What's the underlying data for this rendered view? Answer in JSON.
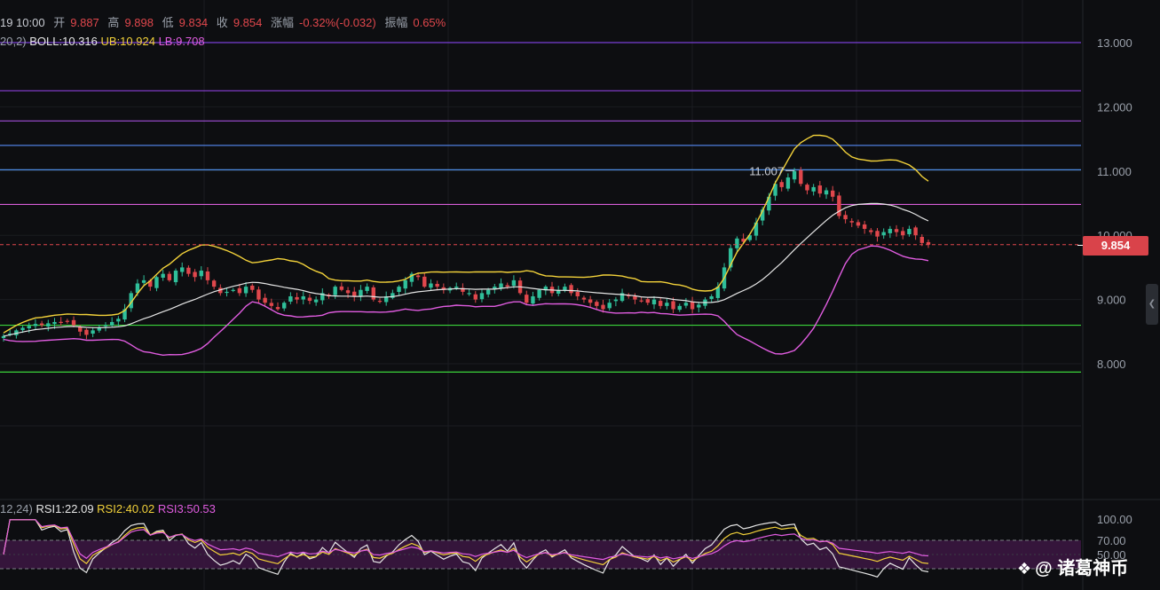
{
  "info": {
    "time": "19 10:00",
    "open_label": "开",
    "open": "9.887",
    "high_label": "高",
    "high": "9.898",
    "low_label": "低",
    "low": "9.834",
    "close_label": "收",
    "close": "9.854",
    "change_label": "涨幅",
    "change": "-0.32%(-0.032)",
    "amp_label": "振幅",
    "amp": "0.65%"
  },
  "boll": {
    "params": "20,2)",
    "mid": "BOLL:10.316",
    "ub": "UB:10.924",
    "lb": "LB:9.708"
  },
  "rsi": {
    "params": "12,24)",
    "rsi1": "RSI1:22.09",
    "rsi2": "RSI2:40.02",
    "rsi3": "RSI3:50.53"
  },
  "current_price": "9.854",
  "high_marker": "11.007",
  "scroll_icon": "chevron-left-icon",
  "watermark": {
    "icon": "diamond-logo-icon",
    "text": "@ 诸葛神币"
  },
  "colors": {
    "up": "#2fbf9a",
    "down": "#e0474c",
    "mid": "#e6e6e6",
    "ub": "#f3d23a",
    "lb": "#e05ce0"
  },
  "chart_data": {
    "type": "candlestick",
    "price_axis": {
      "ticks": [
        13,
        12,
        11,
        10,
        9,
        8
      ],
      "tick_labels": [
        "13.000",
        "12.000",
        "11.000",
        "10.000",
        "9.000",
        "8.000"
      ]
    },
    "rsi_axis": {
      "ticks": [
        100,
        70,
        50
      ],
      "tick_labels": [
        "100.00",
        "70.00",
        "50.00"
      ]
    },
    "horizontal_lines": [
      {
        "price": 13.0,
        "color": "#7a3fd6"
      },
      {
        "price": 12.25,
        "color": "#8a3fd6"
      },
      {
        "price": 11.78,
        "color": "#a04fd8"
      },
      {
        "price": 11.4,
        "color": "#4f7fe0"
      },
      {
        "price": 11.02,
        "color": "#4f8fe8"
      },
      {
        "price": 10.48,
        "color": "#d65cd6"
      },
      {
        "price": 8.6,
        "color": "#3ad43a"
      },
      {
        "price": 7.87,
        "color": "#3ad43a"
      }
    ],
    "closes": [
      8.43,
      8.47,
      8.52,
      8.56,
      8.59,
      8.62,
      8.6,
      8.63,
      8.65,
      8.64,
      8.66,
      8.6,
      8.5,
      8.45,
      8.52,
      8.56,
      8.6,
      8.65,
      8.7,
      8.85,
      9.1,
      9.25,
      9.3,
      9.2,
      9.35,
      9.4,
      9.3,
      9.45,
      9.5,
      9.4,
      9.35,
      9.45,
      9.3,
      9.2,
      9.1,
      9.12,
      9.15,
      9.1,
      9.2,
      9.15,
      9.0,
      8.95,
      8.9,
      8.85,
      8.95,
      9.05,
      9.0,
      9.05,
      8.98,
      9.0,
      9.1,
      9.05,
      9.2,
      9.15,
      9.1,
      9.05,
      9.15,
      9.2,
      9.0,
      8.98,
      9.05,
      9.1,
      9.2,
      9.3,
      9.4,
      9.35,
      9.2,
      9.25,
      9.2,
      9.15,
      9.18,
      9.2,
      9.12,
      9.1,
      9.0,
      9.1,
      9.15,
      9.2,
      9.25,
      9.2,
      9.3,
      9.1,
      8.95,
      9.05,
      9.15,
      9.2,
      9.1,
      9.15,
      9.2,
      9.1,
      9.05,
      9.0,
      8.95,
      8.9,
      8.85,
      8.95,
      9.0,
      9.1,
      9.05,
      9.0,
      8.98,
      8.95,
      9.0,
      8.9,
      8.95,
      8.85,
      8.9,
      8.95,
      8.85,
      8.92,
      9.0,
      9.05,
      9.2,
      9.5,
      9.8,
      9.95,
      9.9,
      10.0,
      10.2,
      10.4,
      10.6,
      10.8,
      10.75,
      10.9,
      11.0,
      10.8,
      10.7,
      10.75,
      10.65,
      10.7,
      10.6,
      10.3,
      10.25,
      10.2,
      10.15,
      10.1,
      10.05,
      9.98,
      10.05,
      10.1,
      10.05,
      10.0,
      10.1,
      10.0,
      9.88,
      9.854
    ],
    "rsi_series": [
      {
        "name": "RSI1",
        "color": "#e6e6e6"
      },
      {
        "name": "RSI2",
        "color": "#f3d23a"
      },
      {
        "name": "RSI3",
        "color": "#e05ce0"
      }
    ]
  }
}
